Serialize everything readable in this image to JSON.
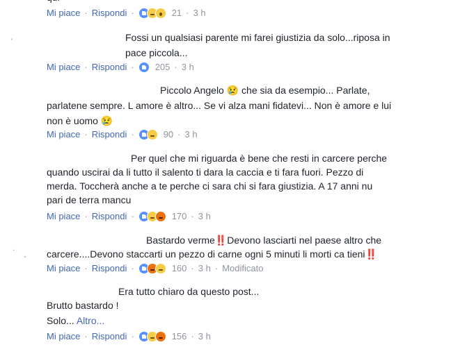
{
  "labels": {
    "like": "Mi piace",
    "reply": "Rispondi",
    "separator": "·",
    "more": "Altro..."
  },
  "top": {
    "fragment": "qui",
    "count": "21",
    "time": "3 h"
  },
  "comments": [
    {
      "lines": [
        "Fossi un qualsiasi parente mi farei giustizia da solo...riposa in",
        "pace piccola..."
      ],
      "count": "205",
      "time": "3 h"
    },
    {
      "lines": [
        "Piccolo Angelo 😢 che sia da esempio... Parlate,",
        "parlatene sempre. L amore è altro... Se vi alza mani fidatevi... Non è amore e lui",
        "non è uomo 😢"
      ],
      "count": "90",
      "time": "3 h"
    },
    {
      "lines": [
        "Per quel che mi riguarda è bene che resti in carcere perche",
        "quando uscirai da li tutto il salento ti dara la caccia e ti fara fuori. Pezzo di",
        "merda. Toccherà anche a te perche ci sara chi si fara giustizia. A 17 anni nu",
        "pari de terra mancu"
      ],
      "count": "170",
      "time": "3 h"
    },
    {
      "lines": [
        "Bastardo verme‼️Devono lasciarti nel paese altro che",
        "carcere....Devono staccarti un pezzo di carne ogni 5 minuti li morti ca tieni‼️"
      ],
      "count": "160",
      "time": "3 h",
      "edited": "Modificato"
    },
    {
      "lines": [
        "Era tutto chiaro da questo post...",
        "Brutto bastardo !",
        "Solo..."
      ],
      "count": "156",
      "time": "3 h"
    }
  ]
}
